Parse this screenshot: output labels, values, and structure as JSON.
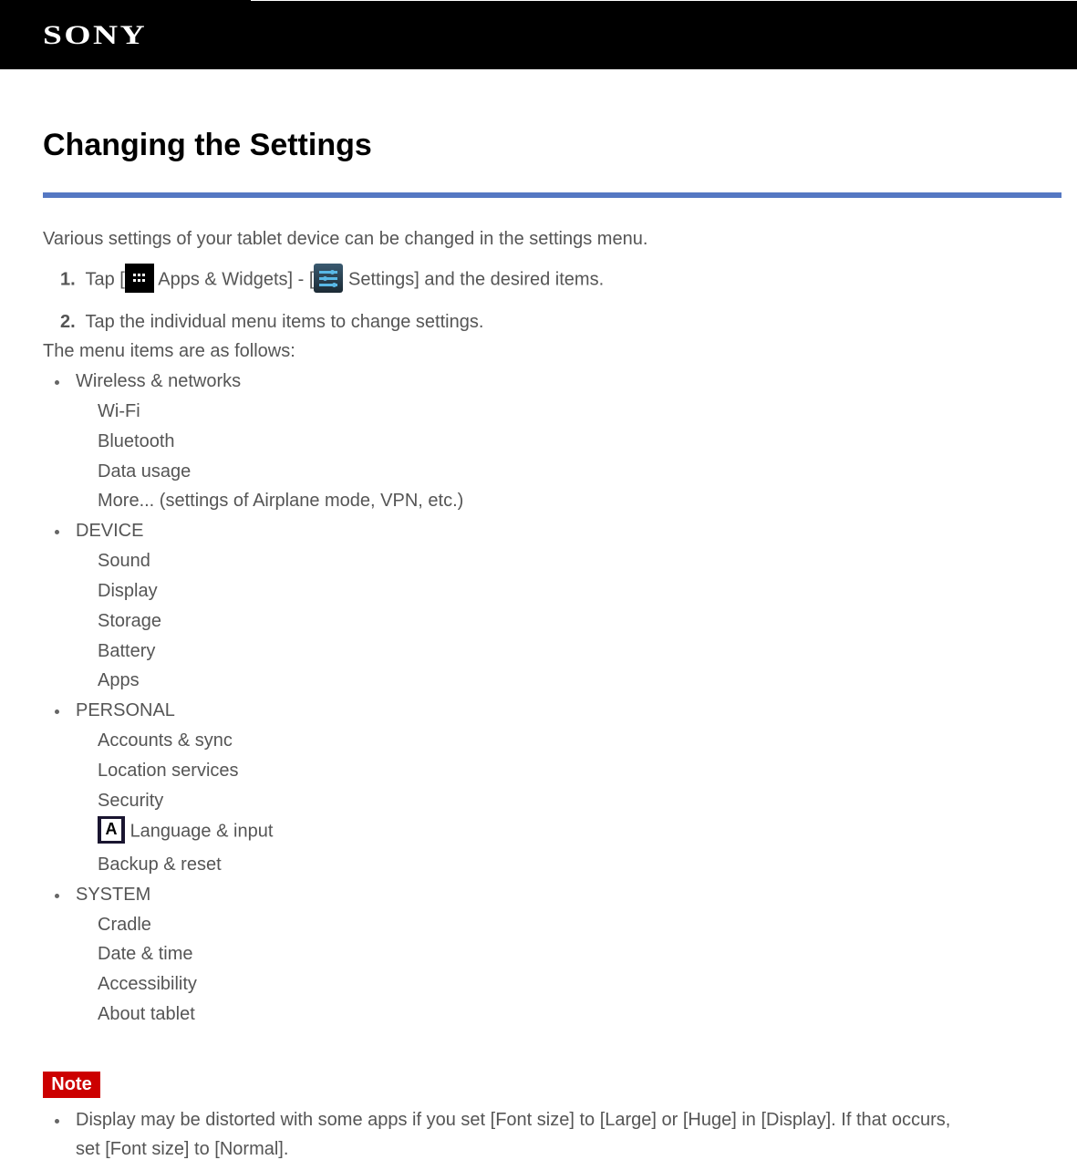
{
  "header": {
    "brand": "SONY"
  },
  "page": {
    "title": "Changing the Settings",
    "intro": "Various settings of your tablet device can be changed in the settings menu.",
    "steps": [
      {
        "num": "1.",
        "pre": "Tap [",
        "icon1": "apps-widgets-icon",
        "mid1": " Apps & Widgets] - [",
        "icon2": "settings-icon",
        "post": " Settings] and the desired items."
      },
      {
        "num": "2.",
        "text": "Tap the individual menu items to change settings."
      }
    ],
    "list_intro": "The menu items are as follows:",
    "categories": [
      {
        "label": "Wireless & networks",
        "items": [
          "Wi-Fi",
          "Bluetooth",
          "Data usage",
          "More... (settings of Airplane mode, VPN, etc.)"
        ]
      },
      {
        "label": "DEVICE",
        "items": [
          "Sound",
          "Display",
          "Storage",
          "Battery",
          "Apps"
        ]
      },
      {
        "label": "PERSONAL",
        "items": [
          "Accounts & sync",
          "Location services",
          "Security",
          "Language & input",
          "Backup & reset"
        ]
      },
      {
        "label": "SYSTEM",
        "items": [
          "Cradle",
          "Date & time",
          "Accessibility",
          "About tablet"
        ]
      }
    ],
    "language_icon_glyph": "A",
    "note": {
      "label": "Note",
      "lines": [
        "Display may be distorted with some apps if you set [Font size] to [Large] or [Huge] in [Display]. If that occurs,",
        "set [Font size] to [Normal]."
      ]
    }
  }
}
